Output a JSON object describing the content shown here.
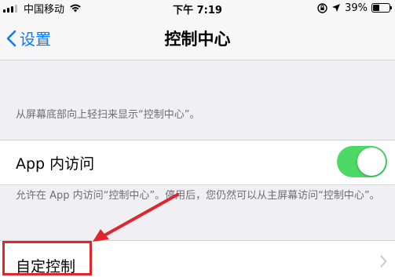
{
  "status_bar": {
    "carrier": "中国移动",
    "time": "下午 7:19",
    "battery": "39%",
    "battery_level": 0.39
  },
  "nav": {
    "back_label": "设置",
    "title": "控制中心"
  },
  "description_top": "从屏幕底部向上轻扫来显示“控制中心”。",
  "app_access": {
    "label": "App 内访问",
    "toggle_on": true,
    "toggle_color": "#4cd964"
  },
  "description_access": "允许在 App 内访问“控制中心”。停用后，您仍然可以从主屏幕访问“控制中心”。",
  "customize": {
    "label": "自定控制"
  },
  "colors": {
    "accent": "#0a7aff",
    "annotation": "#e0262d"
  }
}
